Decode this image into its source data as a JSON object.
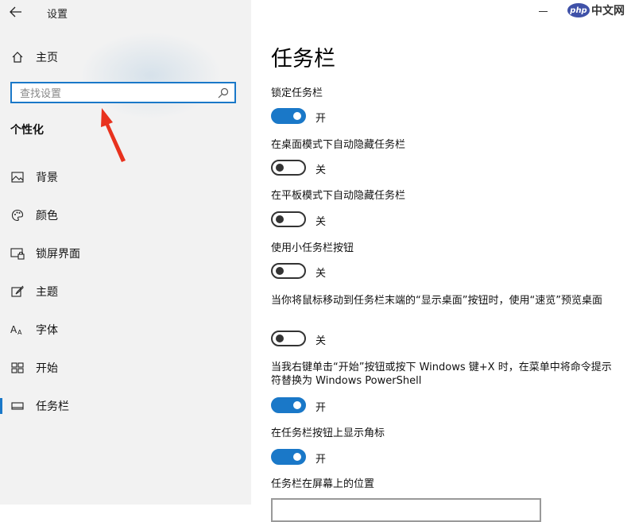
{
  "window": {
    "title": "设置"
  },
  "sidebar": {
    "home_label": "主页",
    "search_placeholder": "查找设置",
    "section_title": "个性化",
    "items": [
      {
        "label": "背景",
        "icon": "picture-icon"
      },
      {
        "label": "颜色",
        "icon": "palette-icon"
      },
      {
        "label": "锁屏界面",
        "icon": "lock-screen-icon"
      },
      {
        "label": "主题",
        "icon": "theme-brush-icon"
      },
      {
        "label": "字体",
        "icon": "font-icon"
      },
      {
        "label": "开始",
        "icon": "start-grid-icon"
      },
      {
        "label": "任务栏",
        "icon": "taskbar-icon",
        "selected": true
      }
    ]
  },
  "watermark": {
    "badge": "php",
    "text": "中文网"
  },
  "main": {
    "title": "任务栏",
    "settings": [
      {
        "label": "锁定任务栏",
        "state": "on",
        "state_label": "开"
      },
      {
        "label": "在桌面模式下自动隐藏任务栏",
        "state": "off",
        "state_label": "关"
      },
      {
        "label": "在平板模式下自动隐藏任务栏",
        "state": "off",
        "state_label": "关"
      },
      {
        "label": "使用小任务栏按钮",
        "state": "off",
        "state_label": "关"
      },
      {
        "label": "当你将鼠标移动到任务栏末端的“显示桌面”按钮时，使用“速览”预览桌面",
        "state": "off",
        "state_label": "关"
      },
      {
        "label": "当我右键单击“开始”按钮或按下 Windows 键+X 时，在菜单中将命令提示符替换为 Windows PowerShell",
        "state": "on",
        "state_label": "开"
      },
      {
        "label": "在任务栏按钮上显示角标",
        "state": "on",
        "state_label": "开"
      }
    ],
    "position_label": "任务栏在屏幕上的位置"
  },
  "colors": {
    "accent": "#1a78c8",
    "sidebar_bg": "#f2f2f2",
    "arrow": "#e8321e"
  }
}
